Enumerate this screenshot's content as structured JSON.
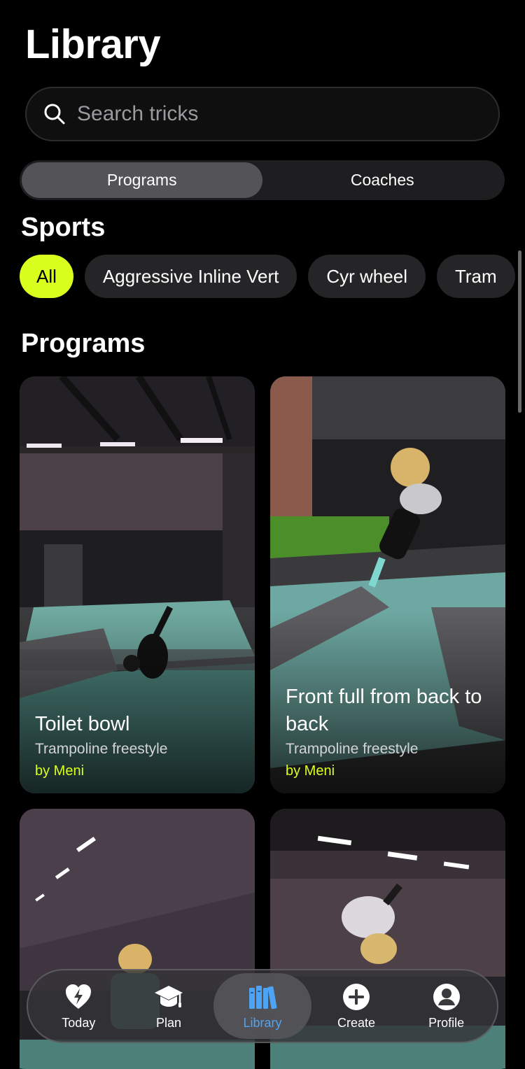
{
  "header": {
    "title": "Library"
  },
  "search": {
    "placeholder": "Search tricks"
  },
  "segments": [
    {
      "label": "Programs",
      "active": true
    },
    {
      "label": "Coaches",
      "active": false
    }
  ],
  "sports": {
    "title": "Sports",
    "chips": [
      "All",
      "Aggressive Inline Vert",
      "Cyr wheel",
      "Tram"
    ]
  },
  "programs": {
    "title": "Programs",
    "cards": [
      {
        "title": "Toilet bowl",
        "sport": "Trampoline freestyle",
        "author": "by Meni"
      },
      {
        "title": "Front full from back to back",
        "sport": "Trampoline freestyle",
        "author": "by Meni"
      }
    ]
  },
  "tabbar": {
    "items": [
      {
        "label": "Today",
        "icon": "heart-bolt-icon"
      },
      {
        "label": "Plan",
        "icon": "graduation-cap-icon"
      },
      {
        "label": "Library",
        "icon": "books-icon",
        "active": true
      },
      {
        "label": "Create",
        "icon": "plus-circle-icon"
      },
      {
        "label": "Profile",
        "icon": "person-circle-icon"
      }
    ]
  },
  "colors": {
    "accent": "#d9ff1f",
    "active_tab": "#4ea3f5",
    "background": "#000000"
  }
}
